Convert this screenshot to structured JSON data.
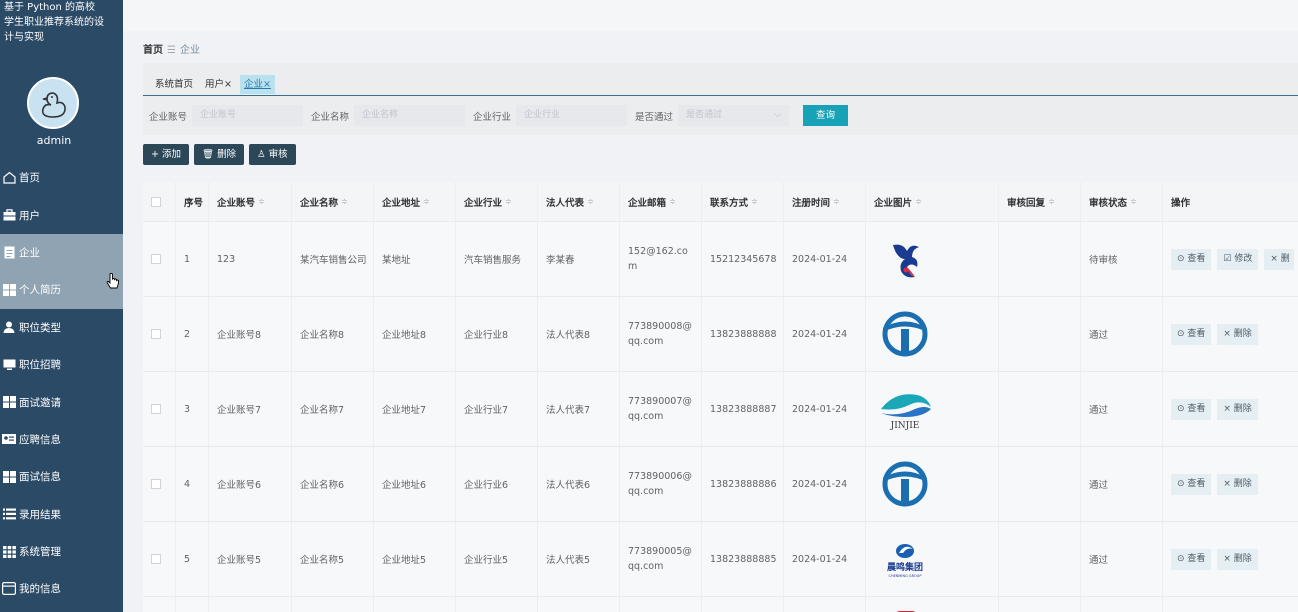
{
  "app": {
    "title": "基于 Python 的高校学生职业推荐系统的设计与实现"
  },
  "user": {
    "name": "admin"
  },
  "sidebar": {
    "items": [
      {
        "label": "首页",
        "icon": "home-icon"
      },
      {
        "label": "用户",
        "icon": "briefcase-icon"
      },
      {
        "label": "企业",
        "icon": "document-icon"
      },
      {
        "label": "个人简历",
        "icon": "grid-icon"
      },
      {
        "label": "职位类型",
        "icon": "person-icon"
      },
      {
        "label": "职位招聘",
        "icon": "monitor-icon"
      },
      {
        "label": "面试邀请",
        "icon": "grid-icon"
      },
      {
        "label": "应聘信息",
        "icon": "id-card-icon"
      },
      {
        "label": "面试信息",
        "icon": "grid-icon"
      },
      {
        "label": "录用结果",
        "icon": "list-icon"
      },
      {
        "label": "系统管理",
        "icon": "apps-icon"
      },
      {
        "label": "我的信息",
        "icon": "window-icon"
      }
    ]
  },
  "breadcrumb": {
    "home": "首页",
    "separator": "☰",
    "current": "企业"
  },
  "tabs": [
    {
      "label": "系统首页"
    },
    {
      "label": "用户×"
    },
    {
      "label": "企业×"
    }
  ],
  "filters": {
    "account": {
      "label": "企业账号",
      "placeholder": "企业账号"
    },
    "name": {
      "label": "企业名称",
      "placeholder": "企业名称"
    },
    "industry": {
      "label": "企业行业",
      "placeholder": "企业行业"
    },
    "approved": {
      "label": "是否通过",
      "placeholder": "是否通过"
    },
    "query_label": "查询"
  },
  "toolbar": {
    "add_label": "+ 添加",
    "delete_label": "🗑 删除",
    "audit_label": "♙ 审核"
  },
  "table": {
    "columns": [
      "序号",
      "企业账号",
      "企业名称",
      "企业地址",
      "企业行业",
      "法人代表",
      "企业邮箱",
      "联系方式",
      "注册时间",
      "企业图片",
      "审核回复",
      "审核状态",
      "操作"
    ],
    "sort_mark": "≑",
    "rows": [
      {
        "index": "1",
        "account": "123",
        "name": "某汽车销售公司",
        "address": "某地址",
        "industry": "汽车销售服务",
        "legal": "李某春",
        "email": "152@162.com",
        "phone": "15212345678",
        "date": "2024-01-24",
        "reply": "",
        "status": "待审核",
        "ops": [
          "⊙ 查看",
          "☑ 修改",
          "× 删"
        ]
      },
      {
        "index": "2",
        "account": "企业账号8",
        "name": "企业名称8",
        "address": "企业地址8",
        "industry": "企业行业8",
        "legal": "法人代表8",
        "email": "773890008@qq.com",
        "phone": "13823888888",
        "date": "2024-01-24",
        "reply": "",
        "status": "通过",
        "ops": [
          "⊙ 查看",
          "× 删除"
        ]
      },
      {
        "index": "3",
        "account": "企业账号7",
        "name": "企业名称7",
        "address": "企业地址7",
        "industry": "企业行业7",
        "legal": "法人代表7",
        "email": "773890007@qq.com",
        "phone": "13823888887",
        "date": "2024-01-24",
        "reply": "",
        "status": "通过",
        "ops": [
          "⊙ 查看",
          "× 删除"
        ]
      },
      {
        "index": "4",
        "account": "企业账号6",
        "name": "企业名称6",
        "address": "企业地址6",
        "industry": "企业行业6",
        "legal": "法人代表6",
        "email": "773890006@qq.com",
        "phone": "13823888886",
        "date": "2024-01-24",
        "reply": "",
        "status": "通过",
        "ops": [
          "⊙ 查看",
          "× 删除"
        ]
      },
      {
        "index": "5",
        "account": "企业账号5",
        "name": "企业名称5",
        "address": "企业地址5",
        "industry": "企业行业5",
        "legal": "法人代表5",
        "email": "773890005@qq.com",
        "phone": "13823888885",
        "date": "2024-01-24",
        "reply": "",
        "status": "通过",
        "ops": [
          "⊙ 查看",
          "× 删除"
        ]
      }
    ],
    "logos": {
      "jinjie": "JINJIE",
      "chenming": "晨鸣集团",
      "chenming_en": "CHENMING GROUP"
    }
  },
  "colors": {
    "sidebar": "#2a4a66",
    "accent": "#17a2b8",
    "dark_button": "#2c4758"
  }
}
